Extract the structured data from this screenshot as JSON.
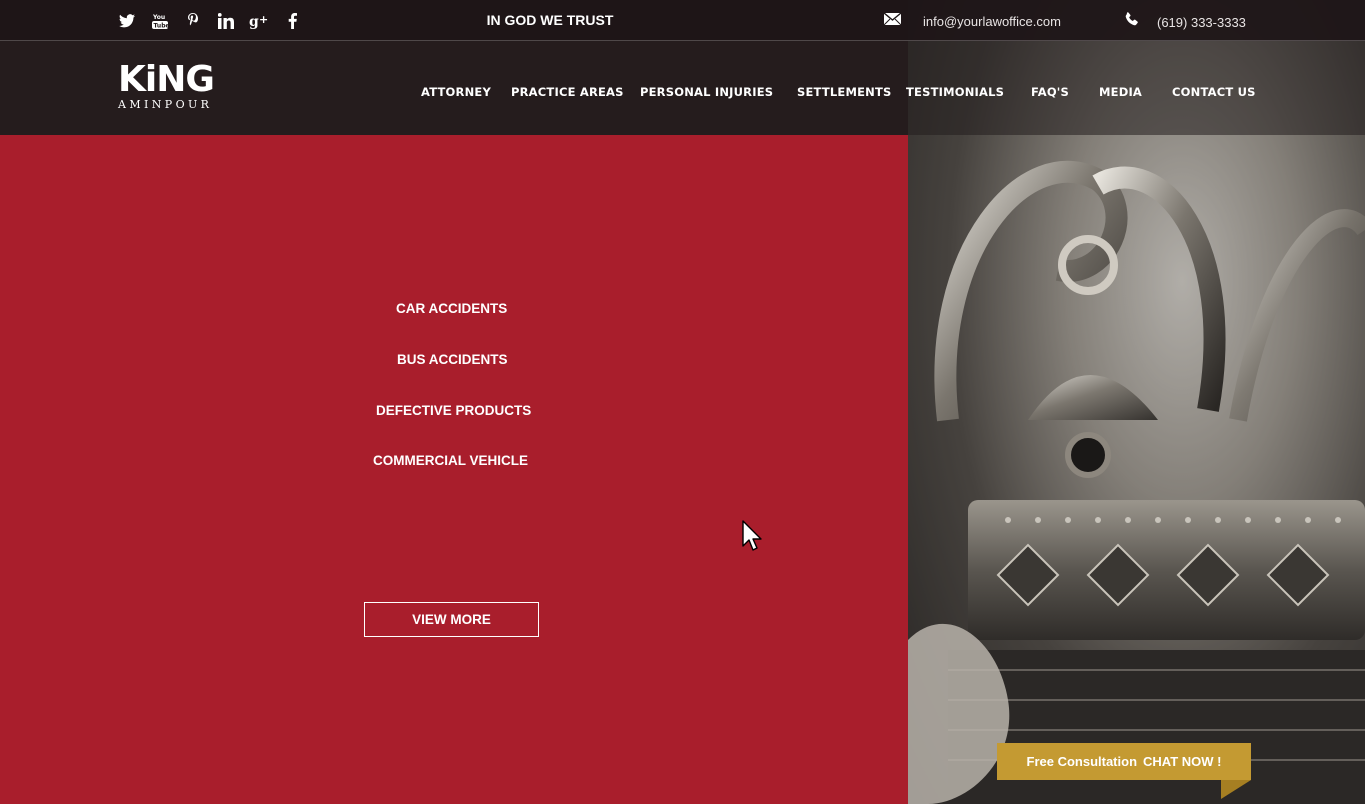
{
  "topbar": {
    "social": [
      {
        "name": "twitter-icon",
        "glyph": "🐦"
      },
      {
        "name": "youtube-icon",
        "glyph": "You\nTube"
      },
      {
        "name": "pinterest-icon",
        "glyph": "p"
      },
      {
        "name": "linkedin-icon",
        "glyph": "in"
      },
      {
        "name": "google-plus-icon",
        "glyph": "g+"
      },
      {
        "name": "facebook-icon",
        "glyph": "f"
      }
    ],
    "motto": "IN GOD WE TRUST",
    "email": "info@yourlawoffice.com",
    "phone": "(619) 333-3333"
  },
  "logo": {
    "main": "KiNG",
    "sub": "AMINPOUR"
  },
  "nav": {
    "items": [
      "ATTORNEY",
      "PRACTICE AREAS",
      "PERSONAL INJURIES",
      "SETTLEMENTS",
      "TESTIMONIALS",
      "FAQ'S",
      "MEDIA",
      "CONTACT US"
    ]
  },
  "main": {
    "areas": [
      "CAR ACCIDENTS",
      "BUS ACCIDENTS",
      "DEFECTIVE PRODUCTS",
      "COMMERCIAL VEHICLE"
    ],
    "view_more": "VIEW MORE"
  },
  "chat": {
    "label_a": "Free Consultation",
    "label_b": "CHAT NOW !"
  },
  "colors": {
    "accent_red": "#a91e2c",
    "header_dark": "#251c1d",
    "chat_gold": "#c49a32"
  }
}
